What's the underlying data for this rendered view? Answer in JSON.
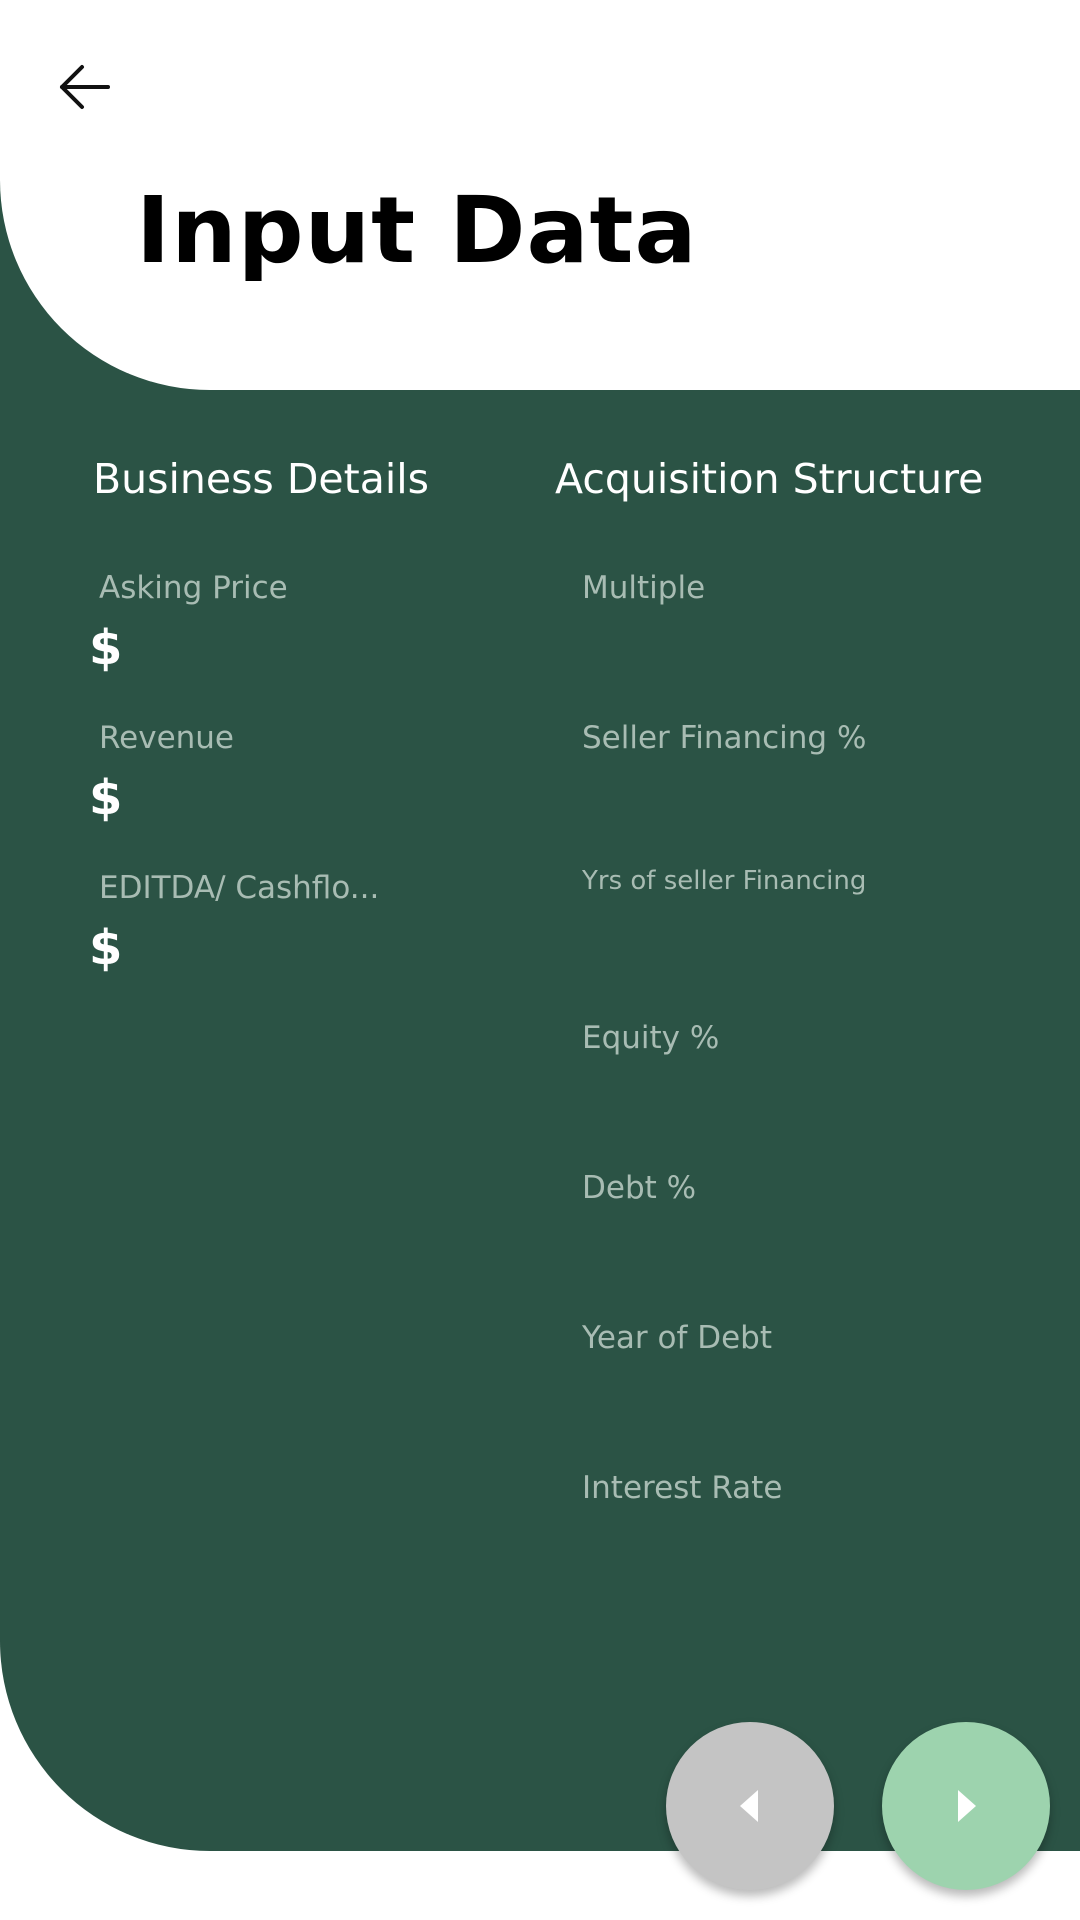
{
  "header": {
    "title": "Input Data",
    "back_icon": "arrow-left-icon"
  },
  "colors": {
    "panel": "#2b5345",
    "label": "#a8bcb3",
    "prev_button": "#c4c4c4",
    "next_button": "#9dd3ae"
  },
  "business": {
    "title": "Business Details",
    "currency_symbol": "$",
    "fields": [
      {
        "label": "Asking Price",
        "value": ""
      },
      {
        "label": "Revenue",
        "value": ""
      },
      {
        "label": "EDITDA/ Cashflo...",
        "value": ""
      }
    ]
  },
  "acquisition": {
    "title": "Acquisition Structure",
    "fields": [
      {
        "label": "Multiple",
        "value": ""
      },
      {
        "label": "Seller Financing %",
        "value": ""
      },
      {
        "label": "Yrs of seller Financing",
        "value": ""
      },
      {
        "label": "Equity %",
        "value": ""
      },
      {
        "label": "Debt %",
        "value": ""
      },
      {
        "label": "Year of Debt",
        "value": ""
      },
      {
        "label": "Interest Rate",
        "value": ""
      }
    ]
  },
  "nav": {
    "prev_icon": "triangle-left-icon",
    "next_icon": "triangle-right-icon"
  }
}
